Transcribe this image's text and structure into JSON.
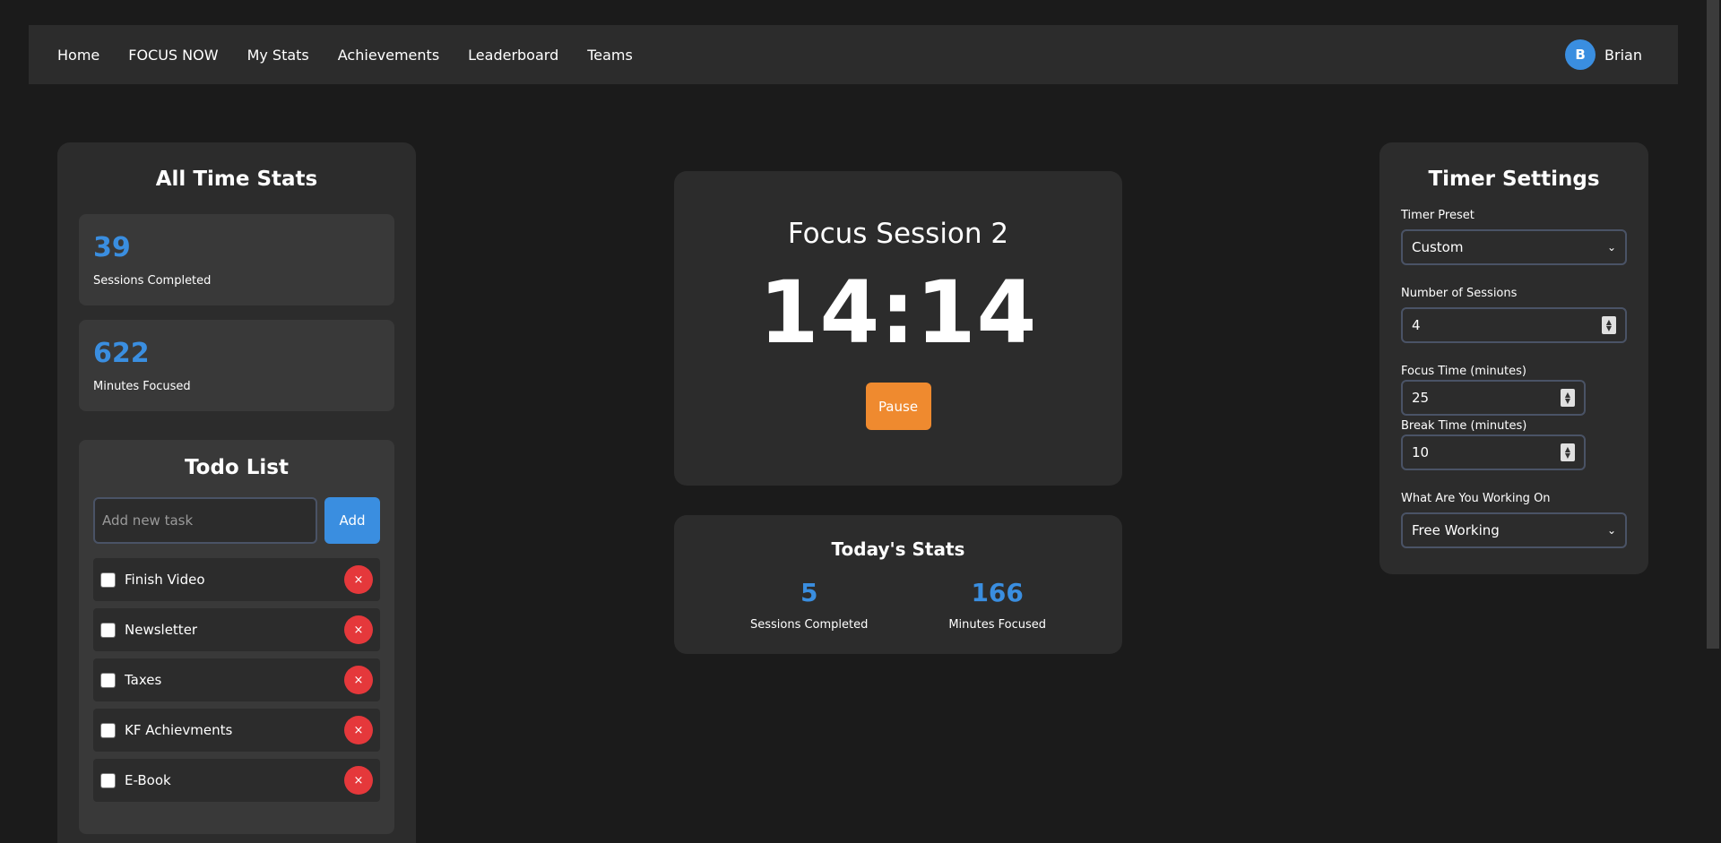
{
  "nav": {
    "links": [
      "Home",
      "FOCUS NOW",
      "My Stats",
      "Achievements",
      "Leaderboard",
      "Teams"
    ],
    "user": {
      "initial": "B",
      "name": "Brian"
    }
  },
  "all_time": {
    "title": "All Time Stats",
    "sessions": {
      "value": "39",
      "label": "Sessions Completed"
    },
    "minutes": {
      "value": "622",
      "label": "Minutes Focused"
    }
  },
  "todo": {
    "title": "Todo List",
    "placeholder": "Add new task",
    "add_label": "Add",
    "delete_symbol": "×",
    "items": [
      "Finish Video",
      "Newsletter",
      "Taxes",
      "KF Achievments",
      "E-Book"
    ]
  },
  "timer": {
    "session_title": "Focus Session 2",
    "display": "14:14",
    "pause_label": "Pause"
  },
  "today": {
    "title": "Today's Stats",
    "sessions": {
      "value": "5",
      "label": "Sessions Completed"
    },
    "minutes": {
      "value": "166",
      "label": "Minutes Focused"
    }
  },
  "settings": {
    "title": "Timer Settings",
    "preset": {
      "label": "Timer Preset",
      "value": "Custom"
    },
    "sessions": {
      "label": "Number of Sessions",
      "value": "4"
    },
    "focus": {
      "label": "Focus Time (minutes)",
      "value": "25"
    },
    "break": {
      "label": "Break Time (minutes)",
      "value": "10"
    },
    "working_on": {
      "label": "What Are You Working On",
      "value": "Free Working"
    }
  },
  "colors": {
    "accent": "#3a8ee0",
    "pause": "#ef8a2f",
    "delete": "#e5383b",
    "background": "#1b1b1b",
    "card": "#2c2c2c"
  }
}
